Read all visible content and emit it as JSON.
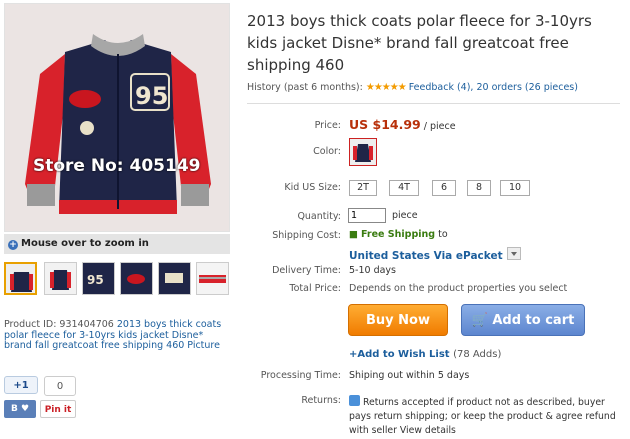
{
  "product": {
    "title": "2013 boys thick coats polar fleece for 3-10yrs kids jacket Disne* brand fall greatcoat free shipping 460",
    "image_watermark": "Store No: 405149",
    "zoom_tip": "Mouse over to zoom in",
    "product_id_label": "Product ID: 931404706",
    "product_id_link": "2013 boys thick coats polar fleece for 3-10yrs kids jacket Disne* brand fall greatcoat free shipping 460 Picture"
  },
  "history": {
    "label": "History (past 6 months):",
    "rating": 5,
    "feedback": "Feedback (4),",
    "orders": "20 orders (26 pieces)"
  },
  "price": {
    "label": "Price:",
    "amount": "US $14.99",
    "unit": "/ piece"
  },
  "color": {
    "label": "Color:"
  },
  "size": {
    "label": "Kid US Size:",
    "options": [
      "2T",
      "4T",
      "6",
      "8",
      "10"
    ]
  },
  "quantity": {
    "label": "Quantity:",
    "value": "1",
    "unit": "piece"
  },
  "shipping": {
    "label": "Shipping Cost:",
    "free": "Free Shipping",
    "to": "to",
    "method": "United States Via ePacket"
  },
  "delivery": {
    "label": "Delivery Time:",
    "value": "5-10 days"
  },
  "total": {
    "label": "Total Price:",
    "value": "Depends on the product properties you select"
  },
  "actions": {
    "buy_now": "Buy Now",
    "add_to_cart": "Add to cart",
    "wish_list": "+Add to Wish List",
    "wish_count": "(78 Adds)"
  },
  "processing": {
    "label": "Processing Time:",
    "value": "Shiping out within 5 days"
  },
  "returns": {
    "label": "Returns:",
    "value": "Returns accepted if product not as described, buyer pays return shipping; or keep the product & agree refund with seller View details"
  },
  "social": {
    "plus_one": "+1",
    "count": "0",
    "pinit": "Pin it"
  },
  "colors": {
    "price": "#b8300a",
    "link": "#1c5e9c",
    "free_ship": "#3a7c10",
    "buy_now": "#f07b00",
    "add_cart": "#5d86cf"
  }
}
